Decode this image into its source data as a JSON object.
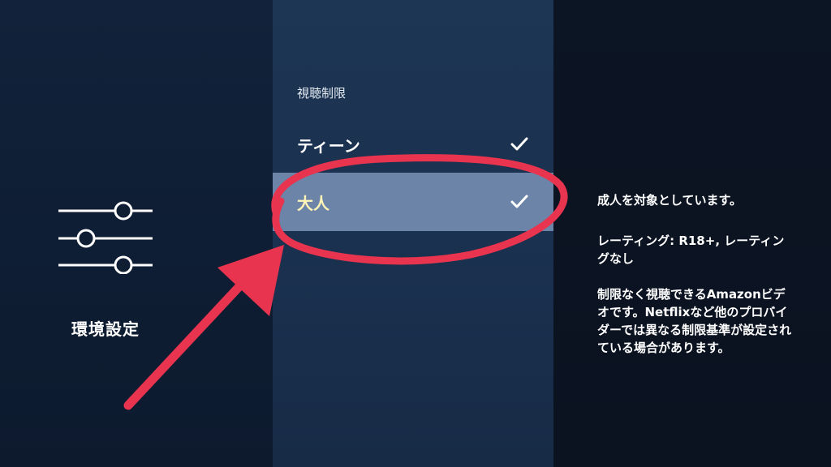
{
  "left_panel": {
    "label": "環境設定",
    "icon": "sliders-icon"
  },
  "menu": {
    "heading": "視聴制限",
    "items": [
      {
        "label": "ティーン",
        "checked": true,
        "selected": false
      },
      {
        "label": "大人",
        "checked": true,
        "selected": true
      }
    ]
  },
  "description": {
    "line1": "成人を対象としています。",
    "line2": "レーティング: R18+, レーティングなし",
    "line3": "制限なく視聴できるAmazonビデオです。Netflixなど他のプロバイダーでは異なる制限基準が設定されている場合があります。"
  },
  "colors": {
    "background": "#0f1a2b",
    "menu_panel": "#1a3150",
    "selected_row": "#6c84a8",
    "selected_text": "#fff4b8",
    "annotation": "#e8344e"
  }
}
